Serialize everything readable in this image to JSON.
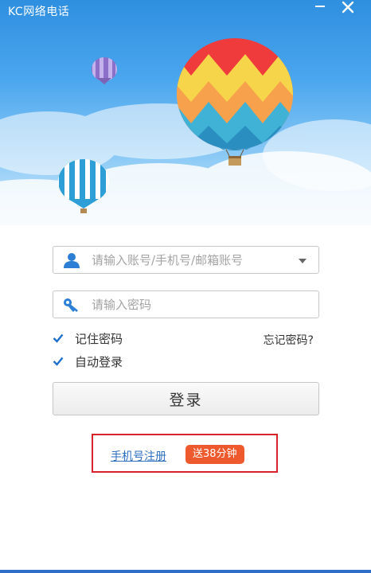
{
  "window": {
    "title": "KC网络电话",
    "minimize_icon": "minimize-icon",
    "close_icon": "close-icon"
  },
  "banner": {
    "theme": "hot-air-balloons",
    "sky_color": "#3f9ae6"
  },
  "login": {
    "account_placeholder": "请输入账号/手机号/邮箱账号",
    "account_value": "",
    "password_placeholder": "请输入密码",
    "password_value": "",
    "remember_password_label": "记住密码",
    "remember_password_checked": true,
    "auto_login_label": "自动登录",
    "auto_login_checked": true,
    "forgot_password_label": "忘记密码?",
    "login_button_label": "登录"
  },
  "register": {
    "link_label": "手机号注册",
    "badge_label": "送38分钟"
  },
  "colors": {
    "accent_blue": "#2f8fe0",
    "badge_orange": "#ee5a2d",
    "highlight_red": "#d8232a",
    "checkmark_blue": "#1f6fcf"
  }
}
